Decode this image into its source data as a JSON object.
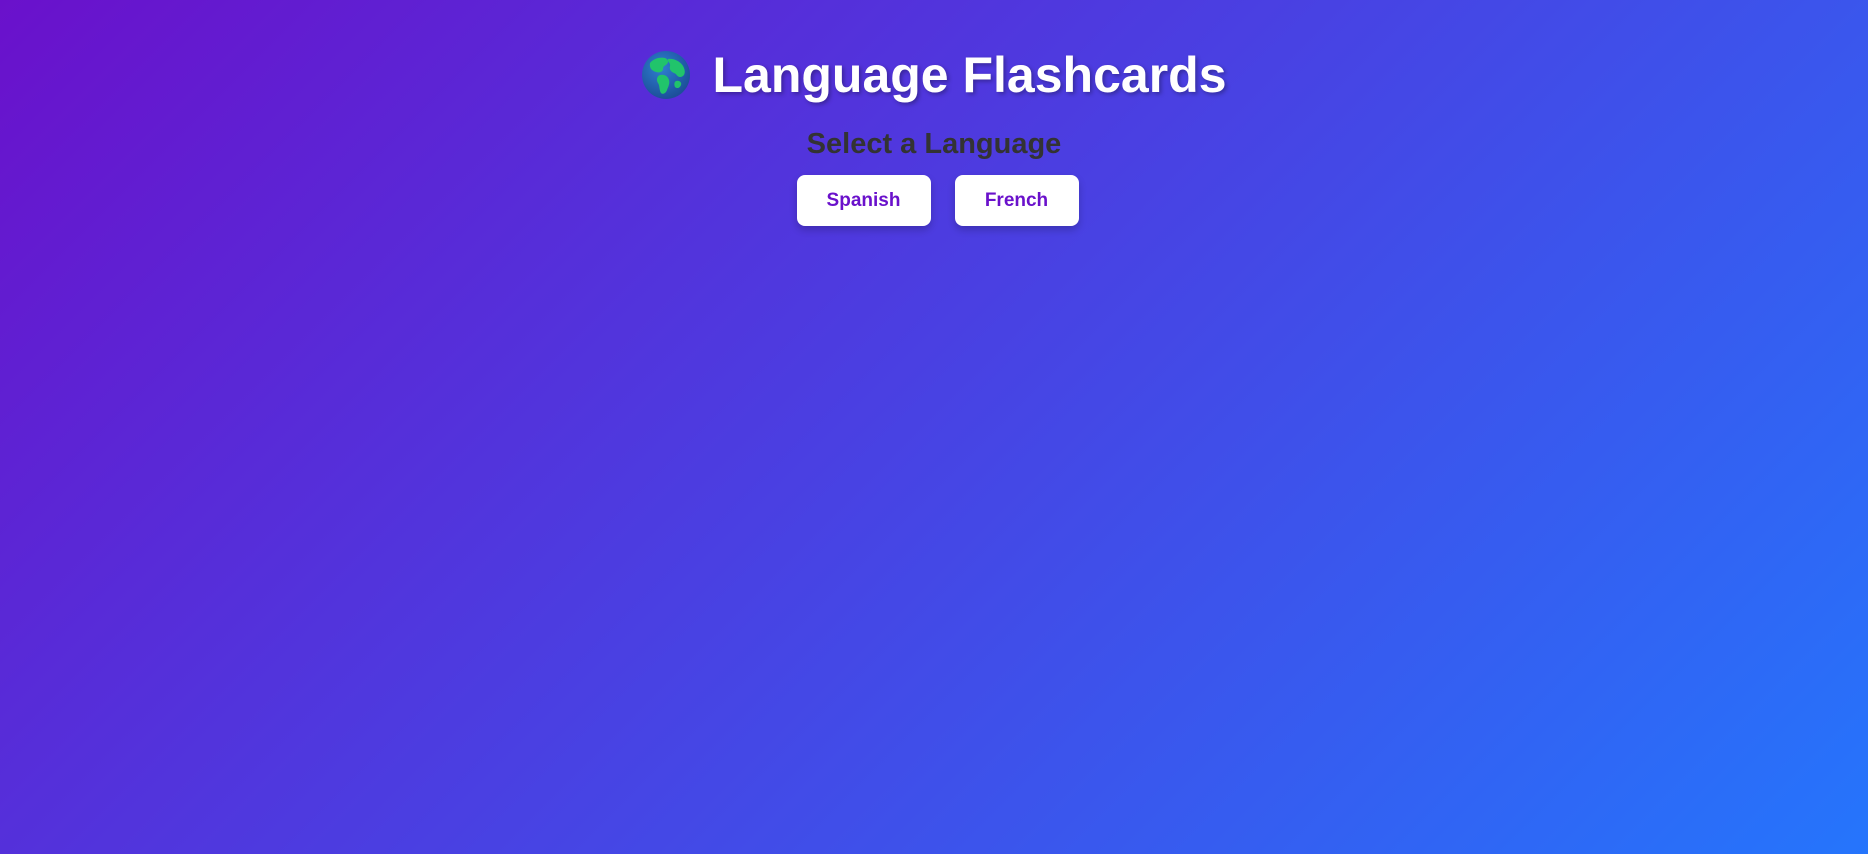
{
  "header": {
    "icon": "globe-icon",
    "title": "Language Flashcards"
  },
  "language_select": {
    "heading": "Select a Language",
    "options": [
      {
        "label": "Spanish"
      },
      {
        "label": "French"
      }
    ]
  },
  "colors": {
    "gradient_start": "#6a11cb",
    "gradient_end": "#2575fc",
    "button_text": "#6a11cb",
    "heading_text": "#333333",
    "title_text": "#ffffff"
  }
}
